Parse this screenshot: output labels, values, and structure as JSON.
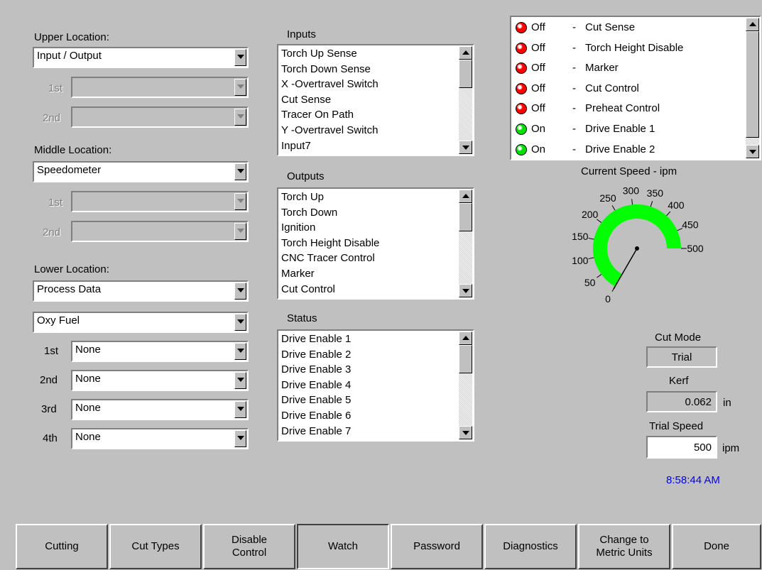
{
  "left_panel": {
    "upper": {
      "label": "Upper Location:",
      "value": "Input / Output",
      "first_label": "1st",
      "second_label": "2nd",
      "first_value": "",
      "second_value": ""
    },
    "middle": {
      "label": "Middle Location:",
      "value": "Speedometer",
      "first_label": "1st",
      "second_label": "2nd",
      "first_value": "",
      "second_value": ""
    },
    "lower": {
      "label": "Lower Location:",
      "value": "Process Data",
      "process": "Oxy Fuel",
      "slots": [
        {
          "label": "1st",
          "value": "None"
        },
        {
          "label": "2nd",
          "value": "None"
        },
        {
          "label": "3rd",
          "value": "None"
        },
        {
          "label": "4th",
          "value": "None"
        }
      ]
    }
  },
  "inputs": {
    "title": "Inputs",
    "items": [
      "Torch Up Sense",
      "Torch Down Sense",
      "X -Overtravel Switch",
      "Cut Sense",
      "Tracer On Path",
      "Y -Overtravel Switch",
      "Input7"
    ]
  },
  "outputs": {
    "title": "Outputs",
    "items": [
      "Torch Up",
      "Torch Down",
      "Ignition",
      "Torch Height Disable",
      "CNC Tracer Control",
      "Marker",
      "Cut Control"
    ]
  },
  "status": {
    "title": "Status",
    "items": [
      "Drive Enable 1",
      "Drive Enable 2",
      "Drive Enable 3",
      "Drive Enable 4",
      "Drive Enable 5",
      "Drive Enable 6",
      "Drive Enable 7"
    ]
  },
  "io_watch": {
    "colors": {
      "off": "#ff0000",
      "on": "#00e000"
    },
    "items": [
      {
        "state": "Off",
        "on": false,
        "dash": "-",
        "name": "Cut Sense"
      },
      {
        "state": "Off",
        "on": false,
        "dash": "-",
        "name": "Torch Height Disable"
      },
      {
        "state": "Off",
        "on": false,
        "dash": "-",
        "name": "Marker"
      },
      {
        "state": "Off",
        "on": false,
        "dash": "-",
        "name": "Cut Control"
      },
      {
        "state": "Off",
        "on": false,
        "dash": "-",
        "name": "Preheat Control"
      },
      {
        "state": "On",
        "on": true,
        "dash": "-",
        "name": "Drive Enable 1"
      },
      {
        "state": "On",
        "on": true,
        "dash": "-",
        "name": "Drive Enable 2"
      }
    ]
  },
  "speedometer": {
    "title": "Current Speed - ipm",
    "min": 0,
    "max": 500,
    "value": 0,
    "ticks": [
      "0",
      "50",
      "100",
      "150",
      "200",
      "250",
      "300",
      "350",
      "400",
      "450",
      "500"
    ],
    "arc_color": "#00ff00"
  },
  "cut_mode": {
    "label": "Cut Mode",
    "value": "Trial"
  },
  "kerf": {
    "label": "Kerf",
    "value": "0.062",
    "unit": "in"
  },
  "trial_speed": {
    "label": "Trial Speed",
    "value": "500",
    "unit": "ipm"
  },
  "clock": {
    "time": "8:58:44 AM",
    "color": "#0000ff"
  },
  "buttons": {
    "cutting": "Cutting",
    "cut_types": "Cut Types",
    "disable_control_1": "Disable",
    "disable_control_2": "Control",
    "watch": "Watch",
    "password": "Password",
    "diagnostics": "Diagnostics",
    "metric_1": "Change to",
    "metric_2": "Metric Units",
    "done": "Done"
  }
}
